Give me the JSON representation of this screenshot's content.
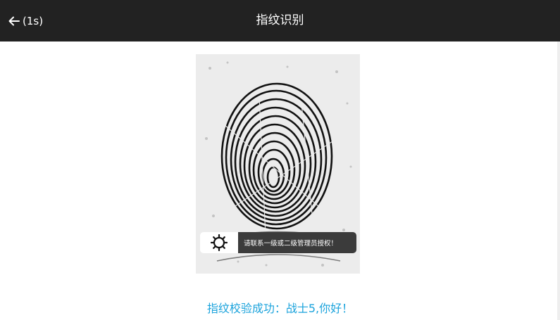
{
  "header": {
    "back_label": "(1s)",
    "title": "指纹识别",
    "back_icon": "left-arrow-icon"
  },
  "toast": {
    "icon": "gear-icon",
    "message": "请联系一级或二级管理员授权！"
  },
  "result": {
    "message": "指纹校验成功：战士5,你好！"
  },
  "colors": {
    "header_bg": "#222222",
    "result_text": "#1ba3dc",
    "toast_bg": "#3b3b3b"
  }
}
